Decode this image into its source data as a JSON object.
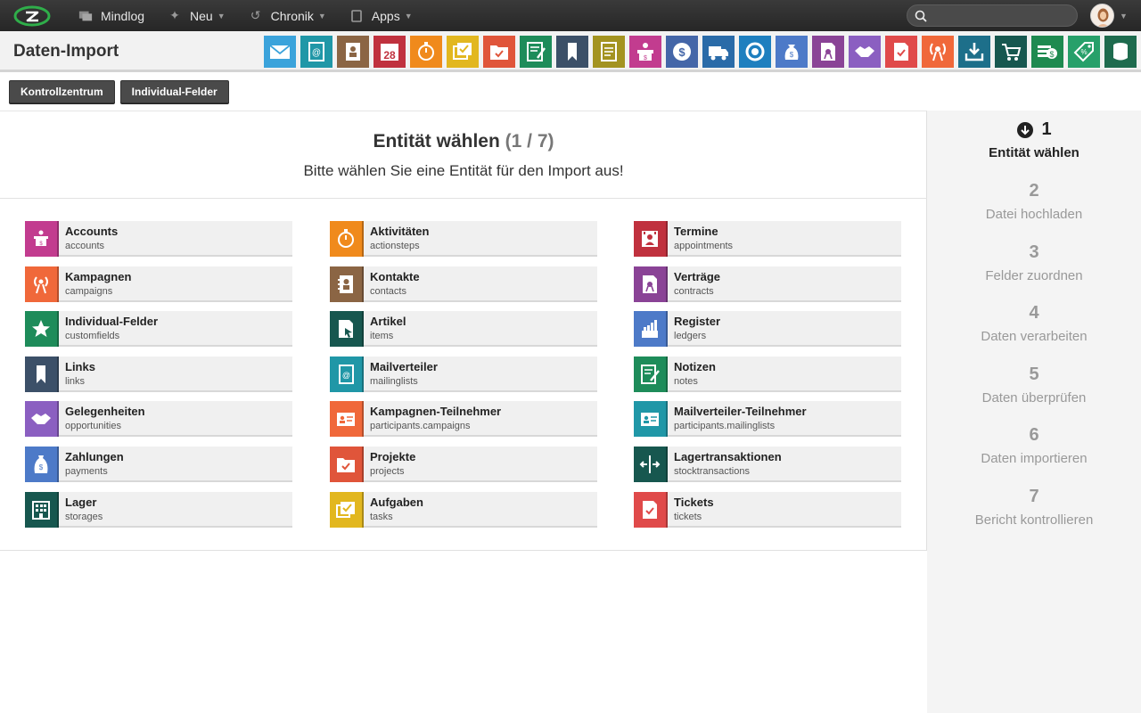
{
  "topbar": {
    "nav": [
      {
        "label": "Mindlog",
        "icon": "message-icon"
      },
      {
        "label": "Neu",
        "icon": "sparkle-icon"
      },
      {
        "label": "Chronik",
        "icon": "history-icon"
      },
      {
        "label": "Apps",
        "icon": "tablet-icon"
      }
    ],
    "search_placeholder": ""
  },
  "header": {
    "title": "Daten-Import",
    "apps": [
      {
        "name": "mail-app",
        "color": "#3ba3db"
      },
      {
        "name": "mailinglist-app",
        "color": "#2097a7"
      },
      {
        "name": "contacts-app",
        "color": "#8b6544"
      },
      {
        "name": "calendar-app",
        "color": "#c0313e",
        "text": "28"
      },
      {
        "name": "timer-app",
        "color": "#f08a1c"
      },
      {
        "name": "tasks-app",
        "color": "#e2b71f"
      },
      {
        "name": "projects-app",
        "color": "#e0553a"
      },
      {
        "name": "notes-app",
        "color": "#1e8c5a"
      },
      {
        "name": "links-app",
        "color": "#3c5068"
      },
      {
        "name": "documents-app",
        "color": "#a39320"
      },
      {
        "name": "accounts-app",
        "color": "#c23c8f"
      },
      {
        "name": "payments-app",
        "color": "#4466a8"
      },
      {
        "name": "shipping-app",
        "color": "#2a6ba8"
      },
      {
        "name": "support-app",
        "color": "#1e7fbf"
      },
      {
        "name": "money-app",
        "color": "#4d7ac8"
      },
      {
        "name": "contracts-app",
        "color": "#8a4396"
      },
      {
        "name": "opportunities-app",
        "color": "#8b5fc1"
      },
      {
        "name": "tickets-app",
        "color": "#e04a4a"
      },
      {
        "name": "campaigns-app",
        "color": "#f0683a"
      },
      {
        "name": "download-app",
        "color": "#1d6f8a"
      },
      {
        "name": "shop-app",
        "color": "#17574f"
      },
      {
        "name": "cash-app",
        "color": "#1e8a50"
      },
      {
        "name": "pricing-app",
        "color": "#27a06a"
      },
      {
        "name": "database-app",
        "color": "#1e6b4e"
      }
    ]
  },
  "buttons": {
    "kontrollzentrum": "Kontrollzentrum",
    "individual": "Individual-Felder"
  },
  "main": {
    "title": "Entität wählen",
    "step_counter": "(1 / 7)",
    "subtitle": "Bitte wählen Sie eine Entität für den Import aus!"
  },
  "entities": [
    {
      "label": "Accounts",
      "sub": "accounts",
      "color": "#c23c8f",
      "icon": "accounts-icon"
    },
    {
      "label": "Aktivitäten",
      "sub": "actionsteps",
      "color": "#f08a1c",
      "icon": "stopwatch-icon"
    },
    {
      "label": "Termine",
      "sub": "appointments",
      "color": "#c0313e",
      "icon": "appointment-icon"
    },
    {
      "label": "Kampagnen",
      "sub": "campaigns",
      "color": "#f0683a",
      "icon": "broadcast-icon"
    },
    {
      "label": "Kontakte",
      "sub": "contacts",
      "color": "#8b6544",
      "icon": "contacts-icon"
    },
    {
      "label": "Verträge",
      "sub": "contracts",
      "color": "#8a4396",
      "icon": "contract-icon"
    },
    {
      "label": "Individual-Felder",
      "sub": "customfields",
      "color": "#1e8c5a",
      "icon": "star-icon"
    },
    {
      "label": "Artikel",
      "sub": "items",
      "color": "#17574f",
      "icon": "item-icon"
    },
    {
      "label": "Register",
      "sub": "ledgers",
      "color": "#4d7ac8",
      "icon": "ledger-icon"
    },
    {
      "label": "Links",
      "sub": "links",
      "color": "#3c5068",
      "icon": "bookmark-icon"
    },
    {
      "label": "Mailverteiler",
      "sub": "mailinglists",
      "color": "#2097a7",
      "icon": "mailinglist-icon"
    },
    {
      "label": "Notizen",
      "sub": "notes",
      "color": "#1e8c5a",
      "icon": "note-icon"
    },
    {
      "label": "Gelegenheiten",
      "sub": "opportunities",
      "color": "#8b5fc1",
      "icon": "handshake-icon"
    },
    {
      "label": "Kampagnen-Teilnehmer",
      "sub": "participants.campaigns",
      "color": "#f0683a",
      "icon": "participant-card-icon"
    },
    {
      "label": "Mailverteiler-Teilnehmer",
      "sub": "participants.mailinglists",
      "color": "#2097a7",
      "icon": "participant-card-icon"
    },
    {
      "label": "Zahlungen",
      "sub": "payments",
      "color": "#4d7ac8",
      "icon": "moneybag-icon"
    },
    {
      "label": "Projekte",
      "sub": "projects",
      "color": "#e0553a",
      "icon": "project-folder-icon"
    },
    {
      "label": "Lagertransaktionen",
      "sub": "stocktransactions",
      "color": "#17574f",
      "icon": "transfer-icon"
    },
    {
      "label": "Lager",
      "sub": "storages",
      "color": "#17574f",
      "icon": "warehouse-icon"
    },
    {
      "label": "Aufgaben",
      "sub": "tasks",
      "color": "#e2b71f",
      "icon": "tasks-icon"
    },
    {
      "label": "Tickets",
      "sub": "tickets",
      "color": "#e04a4a",
      "icon": "ticket-icon"
    }
  ],
  "steps": [
    {
      "num": "1",
      "name": "Entität wählen",
      "active": true
    },
    {
      "num": "2",
      "name": "Datei hochladen"
    },
    {
      "num": "3",
      "name": "Felder zuordnen"
    },
    {
      "num": "4",
      "name": "Daten verarbeiten"
    },
    {
      "num": "5",
      "name": "Daten überprüfen"
    },
    {
      "num": "6",
      "name": "Daten importieren"
    },
    {
      "num": "7",
      "name": "Bericht kontrollieren"
    }
  ]
}
